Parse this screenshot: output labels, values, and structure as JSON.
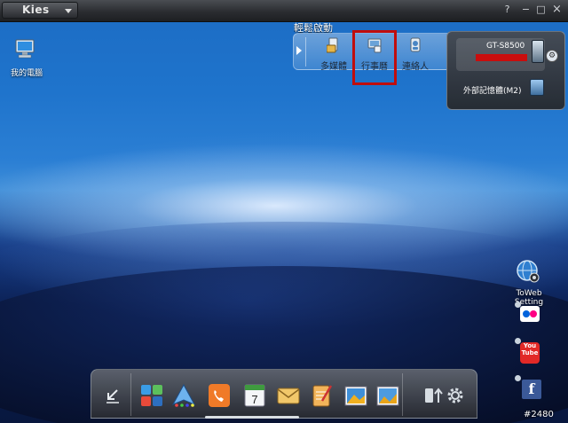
{
  "titlebar": {
    "app_name": "Kies",
    "help_glyph": "?",
    "minimize_glyph": "−",
    "maximize_glyph": "□",
    "close_glyph": "×"
  },
  "desktop": {
    "my_computer_label": "我的電腦"
  },
  "easy_launch": {
    "title": "輕鬆啟動",
    "items": [
      {
        "label": "多媒體",
        "icon": "multimedia-icon"
      },
      {
        "label": "行事曆",
        "icon": "calendar-sync-icon"
      },
      {
        "label": "連絡人",
        "icon": "contacts-icon"
      }
    ]
  },
  "device": {
    "model": "GT-S8500",
    "storage_label": "外部記憶體(M2)"
  },
  "right_links": {
    "toweb_label": "ToWeb Setting",
    "youtube_text": "You Tube",
    "facebook_text": "f"
  },
  "dock": {
    "items": [
      "minimize-arrow-icon",
      "apps-icon",
      "navigator-icon",
      "phone-icon",
      "calendar-icon",
      "messages-icon",
      "memo-icon",
      "photo-icon",
      "gallery-icon",
      "connect-icon",
      "settings-icon"
    ],
    "calendar_day": "7",
    "settings_glyph": "⚙"
  },
  "watermark": "#2480"
}
